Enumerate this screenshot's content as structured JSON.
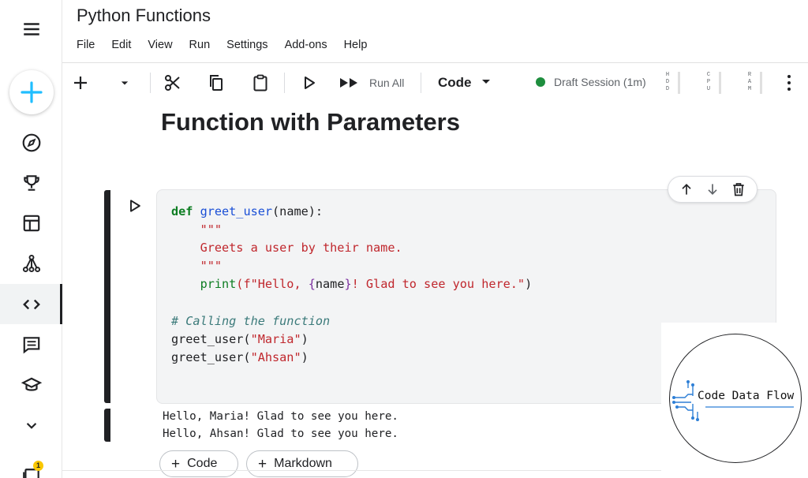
{
  "window": {
    "title": "Python Functions"
  },
  "menu": [
    "File",
    "Edit",
    "View",
    "Run",
    "Settings",
    "Add-ons",
    "Help"
  ],
  "toolbar": {
    "run_all_label": "Run All",
    "cell_type": "Code",
    "session_label": "Draft Session (1m)",
    "session_color": "#1e8e3e",
    "meters": [
      "HDD",
      "CPU",
      "RAM"
    ]
  },
  "sidebar": {
    "icons": [
      "menu-icon",
      "create-plus-icon",
      "compass-icon",
      "trophy-icon",
      "table-icon",
      "models-icon",
      "code-icon",
      "discussion-icon",
      "learn-icon",
      "expand-chevron-icon",
      "notifications-icon"
    ],
    "notification_count": "1",
    "accent_color": "#20beff"
  },
  "content": {
    "heading": "Function with Parameters",
    "code": {
      "kw_def": "def",
      "fn_name": "greet_user",
      "params": "(name):",
      "doc_open": "\"\"\"",
      "doc_text": "Greets a user by their name.",
      "doc_close": "\"\"\"",
      "print_fn": "print",
      "print_open": "(f\"Hello, ",
      "interp_open": "{",
      "interp_var": "name",
      "interp_close": "}",
      "print_rest": "! Glad to see you here.\"",
      "print_close": ")",
      "comment": "# Calling the function",
      "call1_prefix": "greet_user(",
      "call1_arg": "\"Maria\"",
      "call1_suffix": ")",
      "call2_prefix": "greet_user(",
      "call2_arg": "\"Ahsan\"",
      "call2_suffix": ")"
    },
    "output": [
      "Hello, Maria! Glad to see you here.",
      "Hello, Ahsan! Glad to see you here."
    ],
    "add_code_label": "Code",
    "add_markdown_label": "Markdown"
  },
  "watermark": {
    "text": "Code Data Flow"
  }
}
